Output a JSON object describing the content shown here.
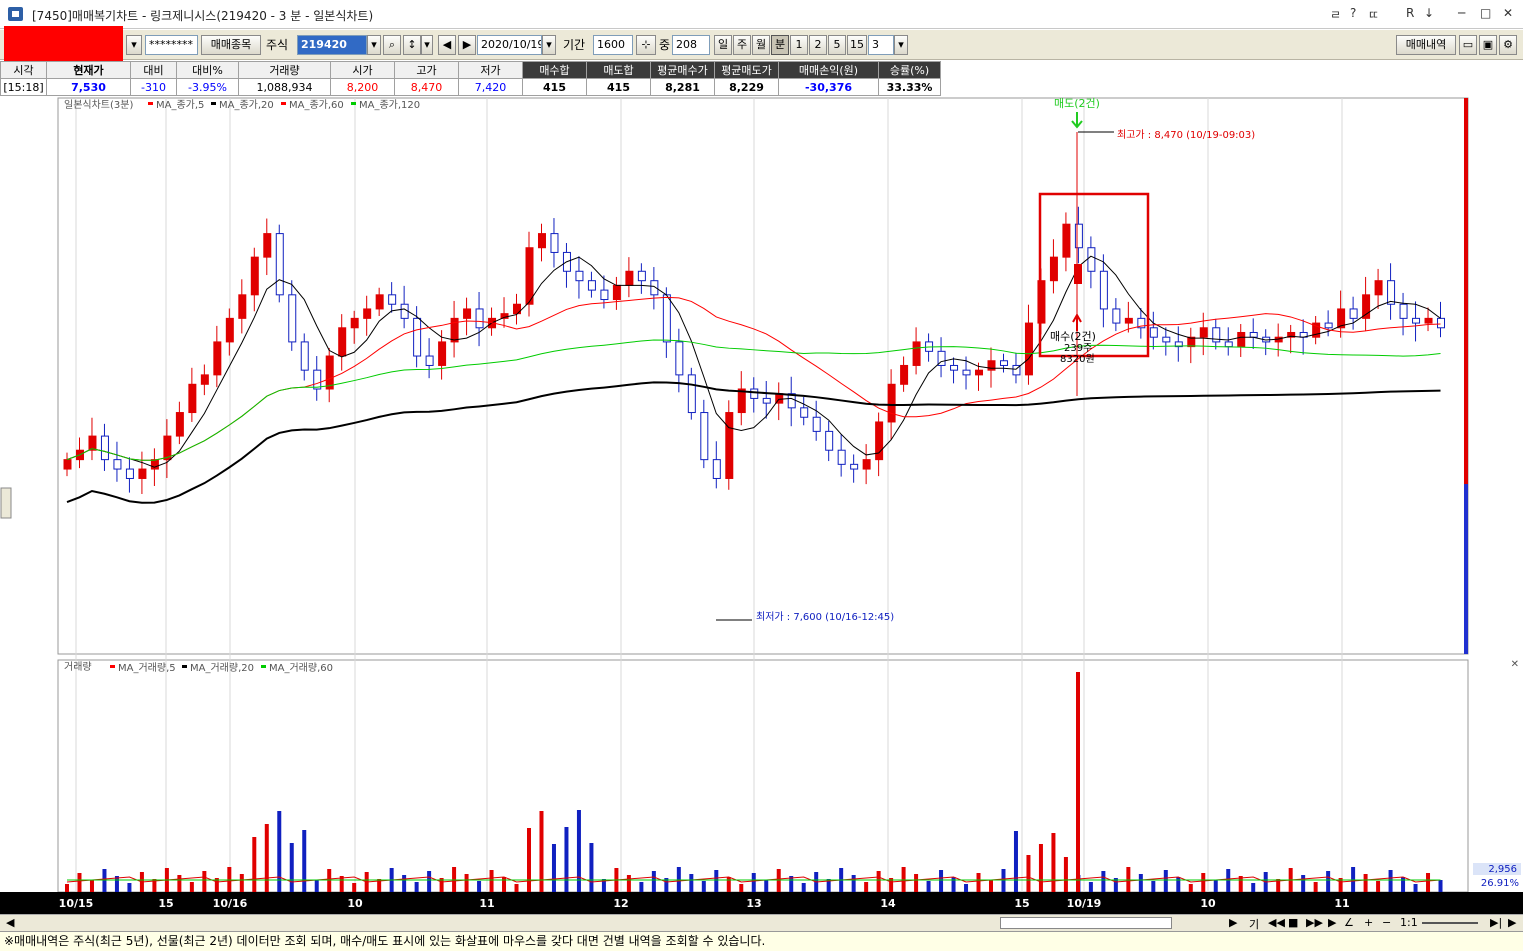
{
  "window": {
    "title": "[7450]매매복기차트 - 링크제니시스(219420 - 3 분 - 일본식차트)",
    "title_buttons": [
      "ㄹ",
      "?",
      "ㄸ",
      "R",
      "↓",
      "─",
      "□",
      "✕"
    ]
  },
  "toolbar": {
    "password_mask": "********",
    "trade_items_button": "매매종목",
    "market_select": "주식",
    "stock_code": "219420",
    "date": "2020/10/19",
    "period_label": "기간",
    "period_value": "1600",
    "count_label": "중",
    "count_value": "208",
    "interval_buttons": [
      "일",
      "주",
      "월",
      "분",
      "1",
      "2",
      "5",
      "15"
    ],
    "interval_selected": "분",
    "interval_value": "3",
    "trade_history_button": "매매내역"
  },
  "summary": {
    "headers": [
      "시각",
      "현재가",
      "대비",
      "대비%",
      "거래량",
      "시가",
      "고가",
      "저가",
      "매수합",
      "매도합",
      "평균매수가",
      "평균매도가",
      "매매손익(원)",
      "승률(%)"
    ],
    "values": [
      "[15:18]",
      "7,530",
      "-310",
      "-3.95%",
      "1,088,934",
      "8,200",
      "8,470",
      "7,420",
      "415",
      "415",
      "8,281",
      "8,229",
      "-30,376",
      "33.33%"
    ],
    "colors": {
      "up": "#ff0000",
      "down": "#0000ff",
      "neutral": "#000000"
    }
  },
  "price_chart": {
    "legend_title": "일본식차트(3분)",
    "legend_items": [
      {
        "label": "MA_종가,5",
        "color": "#ff0000"
      },
      {
        "label": "MA_종가,20",
        "color": "#000000"
      },
      {
        "label": "MA_종가,60",
        "color": "#ff0000"
      },
      {
        "label": "MA_종가,120",
        "color": "#00cc00"
      }
    ],
    "high_annotation": "최고가 : 8,470 (10/19-09:03)",
    "low_annotation": "최저가 : 7,600 (10/16-12:45)",
    "sell_marker": "매도(2건)",
    "buy_marker_line1": "매수(2건)",
    "buy_marker_line2": "239주",
    "buy_marker_line3": "8320원",
    "colors": {
      "up": "#ff0000",
      "down": "#0000ff",
      "ma5": "#000000",
      "ma20": "#ff0000",
      "ma60": "#00cc00",
      "ma120": "#000000"
    }
  },
  "volume_chart": {
    "legend_title": "거래량",
    "legend_items": [
      {
        "label": "MA_거래량,5",
        "color": "#ff0000"
      },
      {
        "label": "MA_거래량,20",
        "color": "#000000"
      },
      {
        "label": "MA_거래량,60",
        "color": "#00cc00"
      }
    ],
    "right_value": "2,956",
    "right_percent": "26.91%"
  },
  "x_axis": {
    "labels": [
      "10/15",
      "15",
      "10/16",
      "10",
      "11",
      "12",
      "13",
      "14",
      "15",
      "10/19",
      "10",
      "11"
    ]
  },
  "scroll_controls": {
    "zoom_label": "1:1",
    "chart_type_label": "기"
  },
  "status_message": "※매매내역은 주식(최근 5년), 선물(최근 2년) 데이터만 조회 되며, 매수/매도 표시에 있는 화살표에 마우스를 갖다 대면 건별 내역을 조회할 수 있습니다.",
  "chart_data": {
    "type": "candlestick",
    "x": [
      "10/15",
      "15",
      "10/16",
      "10",
      "11",
      "12",
      "13",
      "14",
      "15",
      "10/19",
      "10",
      "11"
    ],
    "close_approx": [
      7840,
      8000,
      8220,
      8100,
      8250,
      8050,
      7860,
      7880,
      7900,
      8180,
      7970,
      7950
    ],
    "high": 8470,
    "low": 7600,
    "current": 7530
  }
}
